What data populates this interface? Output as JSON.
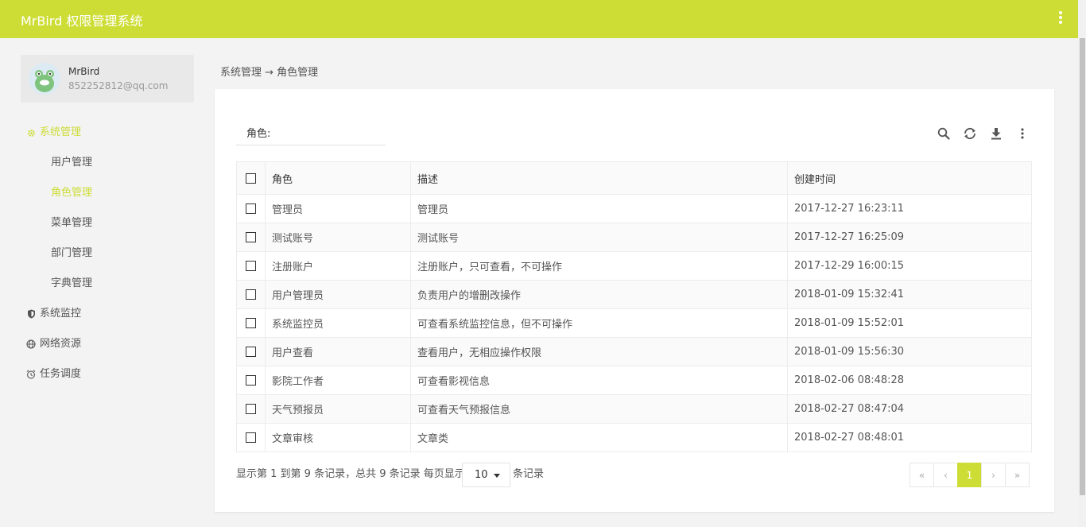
{
  "app": {
    "title": "MrBird 权限管理系统"
  },
  "user": {
    "name": "MrBird",
    "email": "852252812@qq.com"
  },
  "nav": {
    "system": "系统管理",
    "sub": [
      "用户管理",
      "角色管理",
      "菜单管理",
      "部门管理",
      "字典管理"
    ],
    "monitor": "系统监控",
    "network": "网络资源",
    "schedule": "任务调度"
  },
  "breadcrumb": "系统管理 → 角色管理",
  "filter": {
    "label": "角色:",
    "value": ""
  },
  "table": {
    "headers": {
      "role": "角色",
      "desc": "描述",
      "created": "创建时间"
    },
    "rows": [
      {
        "role": "管理员",
        "desc": "管理员",
        "created": "2017-12-27 16:23:11"
      },
      {
        "role": "测试账号",
        "desc": "测试账号",
        "created": "2017-12-27 16:25:09"
      },
      {
        "role": "注册账户",
        "desc": "注册账户，只可查看，不可操作",
        "created": "2017-12-29 16:00:15"
      },
      {
        "role": "用户管理员",
        "desc": "负责用户的增删改操作",
        "created": "2018-01-09 15:32:41"
      },
      {
        "role": "系统监控员",
        "desc": "可查看系统监控信息，但不可操作",
        "created": "2018-01-09 15:52:01"
      },
      {
        "role": "用户查看",
        "desc": "查看用户，无相应操作权限",
        "created": "2018-01-09 15:56:30"
      },
      {
        "role": "影院工作者",
        "desc": "可查看影视信息",
        "created": "2018-02-06 08:48:28"
      },
      {
        "role": "天气预报员",
        "desc": "可查看天气预报信息",
        "created": "2018-02-27 08:47:04"
      },
      {
        "role": "文章审核",
        "desc": "文章类",
        "created": "2018-02-27 08:48:01"
      }
    ]
  },
  "pager": {
    "info": "显示第 1 到第 9 条记录，总共 9 条记录 每页显示",
    "page_size": "10",
    "tail": "条记录",
    "first": "«",
    "prev": "‹",
    "current": "1",
    "next": "›",
    "last": "»"
  },
  "colors": {
    "accent": "#cddd36"
  }
}
